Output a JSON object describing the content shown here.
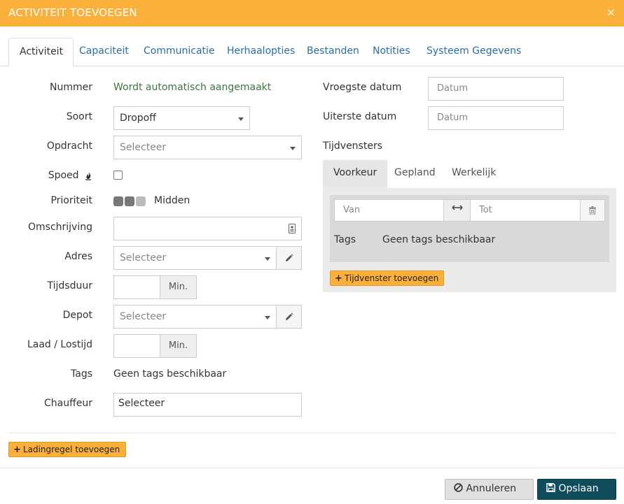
{
  "dialog": {
    "title": "ACTIVITEIT TOEVOEGEN",
    "close_symbol": "×"
  },
  "tabs": [
    {
      "label": "Activiteit",
      "active": true
    },
    {
      "label": "Capaciteit"
    },
    {
      "label": "Communicatie"
    },
    {
      "label": "Herhaalopties"
    },
    {
      "label": "Bestanden"
    },
    {
      "label": "Notities"
    },
    {
      "label": "Systeem Gegevens"
    }
  ],
  "form": {
    "nummer": {
      "label": "Nummer",
      "value": "Wordt automatisch aangemaakt"
    },
    "soort": {
      "label": "Soort",
      "value": "Dropoff"
    },
    "opdracht": {
      "label": "Opdracht",
      "placeholder": "Selecteer"
    },
    "spoed": {
      "label": "Spoed",
      "icon": "fire-icon",
      "checked": false
    },
    "prioriteit": {
      "label": "Prioriteit",
      "value": "Midden",
      "level": 2,
      "max": 3
    },
    "omschrijving": {
      "label": "Omschrijving",
      "value": "",
      "icon": "contact-card-icon"
    },
    "adres": {
      "label": "Adres",
      "placeholder": "Selecteer",
      "icon": "pencil-icon"
    },
    "tijdsduur": {
      "label": "Tijdsduur",
      "value": "",
      "unit": "Min."
    },
    "depot": {
      "label": "Depot",
      "placeholder": "Selecteer",
      "icon": "pencil-icon"
    },
    "laad": {
      "label": "Laad / Lostijd",
      "value": "",
      "unit": "Min."
    },
    "tags": {
      "label": "Tags",
      "value": "Geen tags beschikbaar"
    },
    "chauffeur": {
      "label": "Chauffeur",
      "value": "Selecteer"
    }
  },
  "right": {
    "vroegste": {
      "label": "Vroegste datum",
      "placeholder": "Datum"
    },
    "uiterste": {
      "label": "Uiterste datum",
      "placeholder": "Datum"
    },
    "tijdvensters": {
      "label": "Tijdvensters",
      "subtabs": [
        {
          "label": "Voorkeur",
          "active": true
        },
        {
          "label": "Gepland"
        },
        {
          "label": "Werkelijk"
        }
      ],
      "van_placeholder": "Van",
      "tot_placeholder": "Tot",
      "tags_label": "Tags",
      "tags_value": "Geen tags beschikbaar",
      "add_button": "Tijdvenster toevoegen"
    }
  },
  "ladingregel_button": "Ladingregel toevoegen",
  "footer": {
    "cancel": "Annuleren",
    "save": "Opslaan"
  },
  "colors": {
    "header": "#fbb03b",
    "link": "#2a6ea6",
    "auto_text": "#3c763d",
    "save_button": "#0f4c5c",
    "priority_on": "#777777",
    "priority_off": "#bbbbbb"
  }
}
